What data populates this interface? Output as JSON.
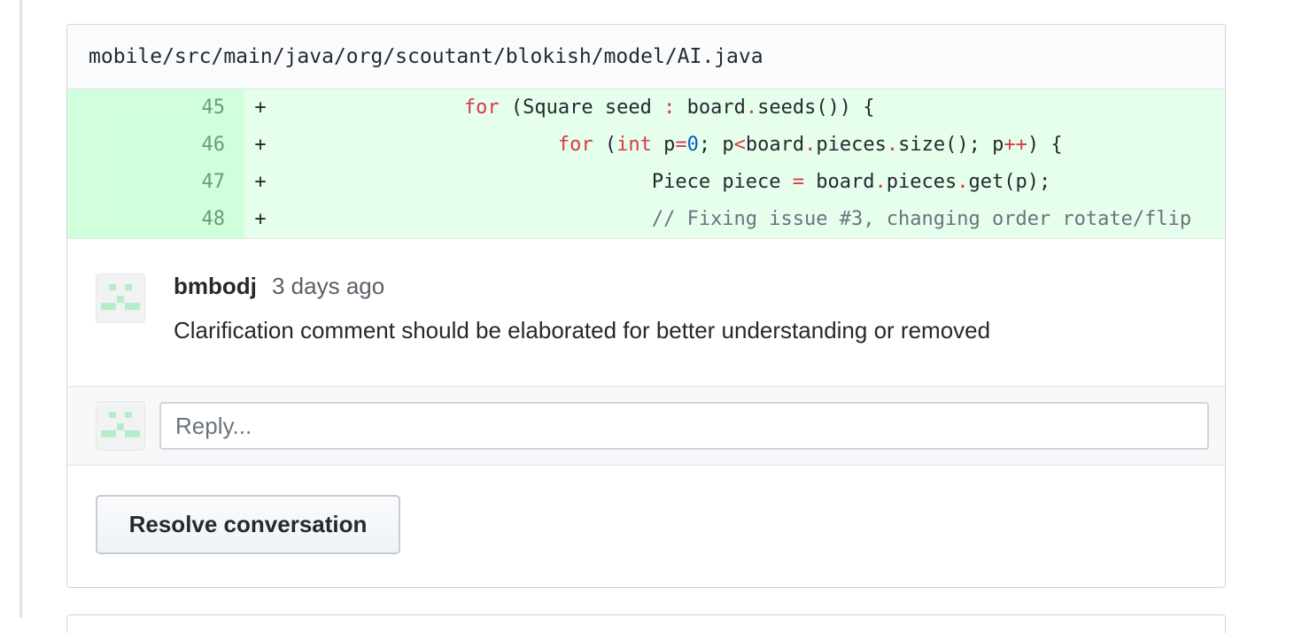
{
  "file": {
    "path": "mobile/src/main/java/org/scoutant/blokish/model/AI.java"
  },
  "diff": {
    "lines": [
      {
        "num": "45",
        "marker": "+",
        "indent": "                ",
        "tokens": [
          {
            "t": "for",
            "c": "kw"
          },
          {
            "t": " (Square seed ",
            "c": ""
          },
          {
            "t": ":",
            "c": "kw"
          },
          {
            "t": " board",
            "c": ""
          },
          {
            "t": ".",
            "c": "kw"
          },
          {
            "t": "seeds()) {",
            "c": ""
          }
        ]
      },
      {
        "num": "46",
        "marker": "+",
        "indent": "                        ",
        "tokens": [
          {
            "t": "for",
            "c": "kw"
          },
          {
            "t": " (",
            "c": ""
          },
          {
            "t": "int",
            "c": "kw"
          },
          {
            "t": " p",
            "c": ""
          },
          {
            "t": "=",
            "c": "kw"
          },
          {
            "t": "0",
            "c": "num"
          },
          {
            "t": "; p",
            "c": ""
          },
          {
            "t": "<",
            "c": "kw"
          },
          {
            "t": "board",
            "c": ""
          },
          {
            "t": ".",
            "c": "kw"
          },
          {
            "t": "pieces",
            "c": ""
          },
          {
            "t": ".",
            "c": "kw"
          },
          {
            "t": "size(); p",
            "c": ""
          },
          {
            "t": "++",
            "c": "kw"
          },
          {
            "t": ") {",
            "c": ""
          }
        ]
      },
      {
        "num": "47",
        "marker": "+",
        "indent": "                                ",
        "tokens": [
          {
            "t": "Piece piece ",
            "c": ""
          },
          {
            "t": "=",
            "c": "kw"
          },
          {
            "t": " board",
            "c": ""
          },
          {
            "t": ".",
            "c": "kw"
          },
          {
            "t": "pieces",
            "c": ""
          },
          {
            "t": ".",
            "c": "kw"
          },
          {
            "t": "get(p);",
            "c": ""
          }
        ]
      },
      {
        "num": "48",
        "marker": "+",
        "indent": "                                ",
        "tokens": [
          {
            "t": "// Fixing issue #3, changing order rotate/flip",
            "c": "cm"
          }
        ]
      }
    ]
  },
  "comment": {
    "author": "bmbodj",
    "time": "3 days ago",
    "body": "Clarification comment should be elaborated for better understanding or removed"
  },
  "reply": {
    "placeholder": "Reply..."
  },
  "actions": {
    "resolve_label": "Resolve conversation"
  },
  "colors": {
    "diff_added_bg": "#e6ffed",
    "diff_added_gutter": "#cdffd8",
    "keyword": "#d73a49",
    "number": "#005cc5",
    "avatar_identicon": "#b8ecc8"
  }
}
